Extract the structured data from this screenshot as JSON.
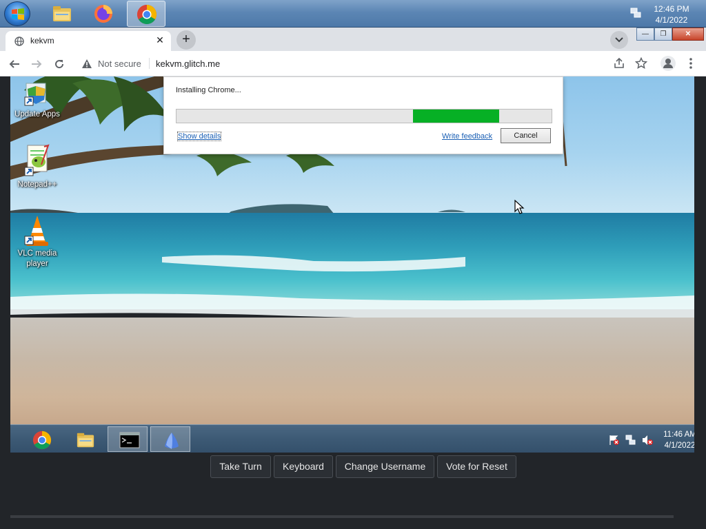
{
  "host": {
    "taskbar": {
      "apps": [
        "windows-explorer",
        "firefox",
        "chrome"
      ],
      "clock_time": "12:46 PM",
      "clock_date": "4/1/2022"
    }
  },
  "browser": {
    "tab_title": "kekvm",
    "tab_close": "✕",
    "new_tab": "+",
    "security_label": "Not secure",
    "url": "kekvm.glitch.me"
  },
  "vm": {
    "desktop_icons": [
      {
        "label": "Update Apps"
      },
      {
        "label": "Notepad++"
      },
      {
        "label": "VLC media player"
      }
    ],
    "installer": {
      "message": "Installing Chrome...",
      "progress_percent": 23,
      "progress_offset_percent": 63,
      "show_details": "Show details",
      "write_feedback": "Write feedback",
      "cancel": "Cancel"
    },
    "taskbar": {
      "clock_time": "11:46 AM",
      "clock_date": "4/1/2022"
    }
  },
  "controls": {
    "take_turn": "Take Turn",
    "keyboard": "Keyboard",
    "change_username": "Change Username",
    "vote_reset": "Vote for Reset"
  },
  "colors": {
    "progress_fill": "#06b025",
    "page_background": "#222529"
  }
}
